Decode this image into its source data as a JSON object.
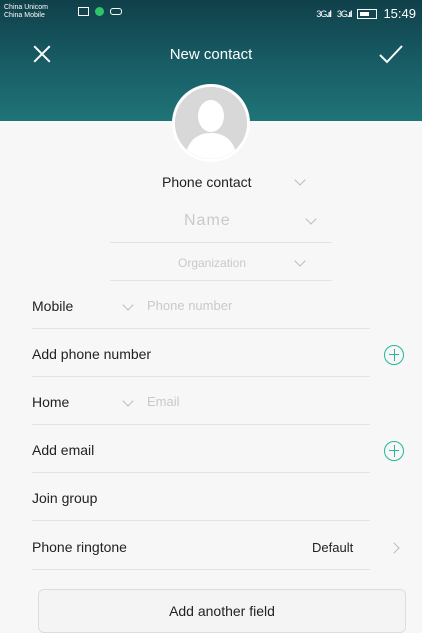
{
  "status_bar": {
    "carrier1": "China Unicom",
    "carrier2": "China Mobile",
    "signal1": "3G",
    "signal2": "3G",
    "time": "15:49"
  },
  "header": {
    "close_icon": "close-icon",
    "title": "New contact",
    "confirm_icon": "check-icon",
    "avatar_icon": "person-silhouette-icon"
  },
  "form": {
    "account": "Phone contact",
    "name_placeholder": "Name",
    "organization_placeholder": "Organization",
    "phone_type": "Mobile",
    "phone_placeholder": "Phone number",
    "add_phone": "Add phone number",
    "email_type": "Home",
    "email_placeholder": "Email",
    "add_email": "Add email",
    "join_group": "Join group",
    "ringtone_label": "Phone ringtone",
    "ringtone_value": "Default",
    "add_field": "Add another field"
  },
  "colors": {
    "header_dark": "#10404a",
    "header_light": "#1f7477",
    "accent": "#26b3a0",
    "status_dot": "#2ec46a"
  }
}
